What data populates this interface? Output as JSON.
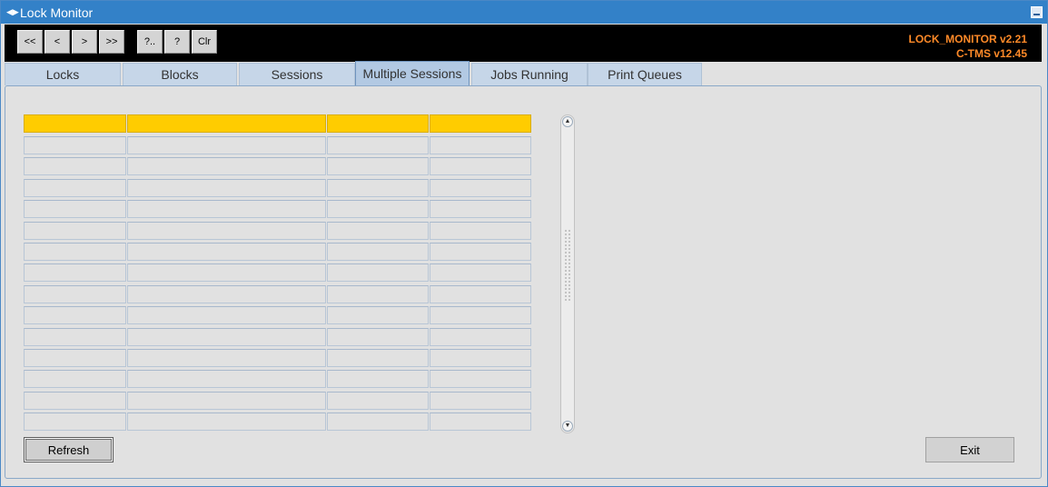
{
  "window": {
    "title": "Lock Monitor",
    "icon": "window-app-icon"
  },
  "toolbar": {
    "buttons": [
      {
        "id": "first",
        "label": "<<"
      },
      {
        "id": "prev",
        "label": "<"
      },
      {
        "id": "next",
        "label": ">"
      },
      {
        "id": "last",
        "label": ">>"
      },
      {
        "id": "query-enter",
        "label": "?.."
      },
      {
        "id": "query-exec",
        "label": "?"
      },
      {
        "id": "clear",
        "label": "Clr"
      }
    ],
    "version_line1": "LOCK_MONITOR v2.21",
    "version_line2": "C-TMS v12.45",
    "version_color": "#ff8a28"
  },
  "tabs": [
    {
      "label": "Locks",
      "active": false
    },
    {
      "label": "Blocks",
      "active": false
    },
    {
      "label": "Sessions",
      "active": false
    },
    {
      "label": "Multiple Sessions",
      "active": true
    },
    {
      "label": "Jobs Running",
      "active": false
    },
    {
      "label": "Print Queues",
      "active": false
    }
  ],
  "grid": {
    "header_color": "#ffcc00",
    "columns": [
      "",
      "",
      "",
      ""
    ],
    "rows": [
      [
        "",
        "",
        "",
        ""
      ],
      [
        "",
        "",
        "",
        ""
      ],
      [
        "",
        "",
        "",
        ""
      ],
      [
        "",
        "",
        "",
        ""
      ],
      [
        "",
        "",
        "",
        ""
      ],
      [
        "",
        "",
        "",
        ""
      ],
      [
        "",
        "",
        "",
        ""
      ],
      [
        "",
        "",
        "",
        ""
      ],
      [
        "",
        "",
        "",
        ""
      ],
      [
        "",
        "",
        "",
        ""
      ],
      [
        "",
        "",
        "",
        ""
      ],
      [
        "",
        "",
        "",
        ""
      ],
      [
        "",
        "",
        "",
        ""
      ],
      [
        "",
        "",
        "",
        ""
      ]
    ]
  },
  "buttons": {
    "refresh": "Refresh",
    "exit": "Exit"
  }
}
